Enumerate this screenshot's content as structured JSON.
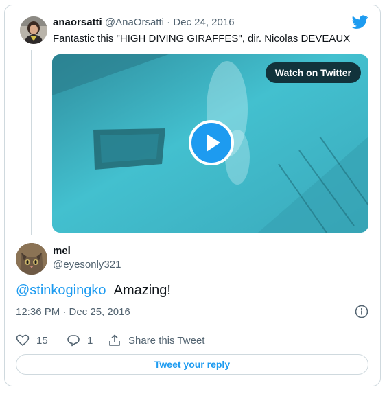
{
  "original_tweet": {
    "display_name": "anaorsatti",
    "handle": "@AnaOrsatti",
    "separator": "·",
    "date": "Dec 24, 2016",
    "text": "Fantastic this \"HIGH DIVING GIRAFFES\", dir. Nicolas DEVEAUX",
    "media": {
      "watch_label": "Watch on Twitter"
    }
  },
  "reply_tweet": {
    "display_name": "mel",
    "handle": "@eyesonly321",
    "mention": "@stinkogingko",
    "text": "Amazing!",
    "timestamp": "12:36 PM · Dec 25, 2016"
  },
  "actions": {
    "likes": "15",
    "replies": "1",
    "share_label": "Share this Tweet"
  },
  "reply_button_label": "Tweet your reply",
  "colors": {
    "accent": "#1d9bf0",
    "muted_text": "#536471",
    "border": "#cfd9de"
  },
  "icons": [
    "twitter-bird-icon",
    "play-icon",
    "info-icon",
    "heart-icon",
    "reply-icon",
    "share-icon"
  ]
}
